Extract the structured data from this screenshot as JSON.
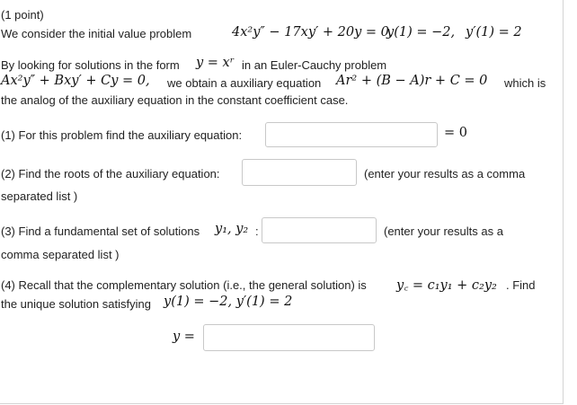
{
  "header": {
    "points": "(1 point)",
    "intro": "We consider the initial value problem",
    "ode": "4x²y″ − 17xy′ + 20y = 0,",
    "ic1": "y(1) = −2,",
    "ic2": "y′(1) = 2"
  },
  "explanation": {
    "line1_prefix": "By looking for solutions in the form",
    "line1_form": "y = xʳ",
    "line1_suffix": "in an Euler-Cauchy problem",
    "line2_eq": "Ax²y″ + Bxy′ + Cy = 0,",
    "line2_mid": "we obtain a auxiliary equation",
    "line2_aux": "Ar² + (B − A)r + C = 0",
    "line2_suffix": "which is",
    "line3": "the analog of the auxiliary equation in the constant coefficient case."
  },
  "q1": {
    "label": "(1) For this problem find the auxiliary equation:",
    "value": "",
    "suffix": "= 0"
  },
  "q2": {
    "label": "(2) Find the roots of the auxiliary equation:",
    "value": "",
    "hint_a": "(enter your results as a comma",
    "hint_b": "separated list )"
  },
  "q3": {
    "label": "(3) Find a fundamental set of solutions",
    "math": "y₁, y₂",
    "colon": ":",
    "value": "",
    "hint_a": "(enter your results as a",
    "hint_b": "comma separated list )"
  },
  "q4": {
    "line1_prefix": "(4) Recall that the complementary solution (i.e., the general solution) is",
    "line1_math": "y꜀ = c₁y₁ + c₂y₂",
    "line1_suffix": ". Find",
    "line2_prefix": "the unique solution satisfying",
    "line2_math": "y(1) = −2,  y′(1) = 2",
    "answer_label": "y =",
    "value": ""
  }
}
